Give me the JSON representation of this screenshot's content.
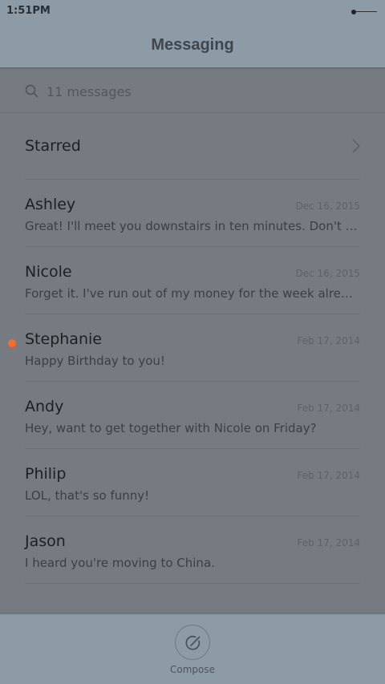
{
  "status_bar": {
    "time": "1:51PM",
    "battery_icon": "battery-icon"
  },
  "header": {
    "title": "Messaging"
  },
  "search": {
    "placeholder": "11 messages",
    "icon": "search-icon"
  },
  "starred": {
    "label": "Starred",
    "icon": "chevron-right-icon"
  },
  "messages": [
    {
      "name": "Ashley",
      "date": "Dec 16, 2015",
      "preview": "Great! I'll meet you downstairs in ten minutes. Don't forget to bring your umbrella.",
      "unread": false
    },
    {
      "name": "Nicole",
      "date": "Dec 16, 2015",
      "preview": "Forget it. I've run out of my money for the week already.",
      "unread": false
    },
    {
      "name": "Stephanie",
      "date": "Feb 17, 2014",
      "preview": "Happy Birthday to you!",
      "unread": true
    },
    {
      "name": "Andy",
      "date": "Feb 17, 2014",
      "preview": "Hey, want to get together with Nicole on Friday?",
      "unread": false
    },
    {
      "name": "Philip",
      "date": "Feb 17, 2014",
      "preview": "LOL, that's so funny!",
      "unread": false
    },
    {
      "name": "Jason",
      "date": "Feb 17, 2014",
      "preview": "I heard you're moving to China.",
      "unread": false
    }
  ],
  "bottom_bar": {
    "compose_label": "Compose",
    "compose_icon": "compose-icon"
  },
  "colors": {
    "chrome": "#8d9ba7",
    "content_background": "#757b80",
    "unread_dot": "#ff6a2a",
    "title_text": "#3f474d"
  }
}
